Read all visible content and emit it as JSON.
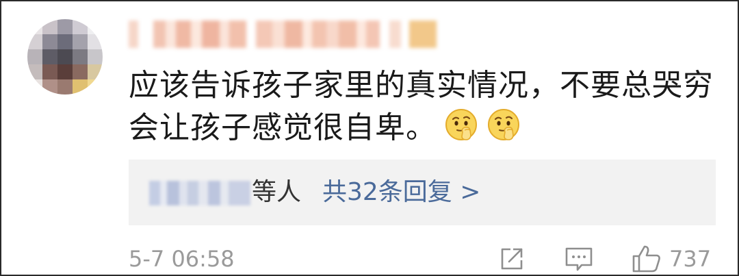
{
  "comment": {
    "text_line1": "应该告诉孩子家里的真实情况，不要总哭穷",
    "text_line2": "会让孩子感觉很自卑。",
    "emoji_icons": [
      "thinking-face-icon",
      "thinking-face-icon"
    ],
    "timestamp": "5-7 06:58",
    "like_count": "737"
  },
  "replies": {
    "suffix": "等人",
    "link_label": "共32条回复 >"
  },
  "colors": {
    "link": "#4a6a9a",
    "muted": "#9a9a9a",
    "reply_bg": "#f2f2f2"
  }
}
